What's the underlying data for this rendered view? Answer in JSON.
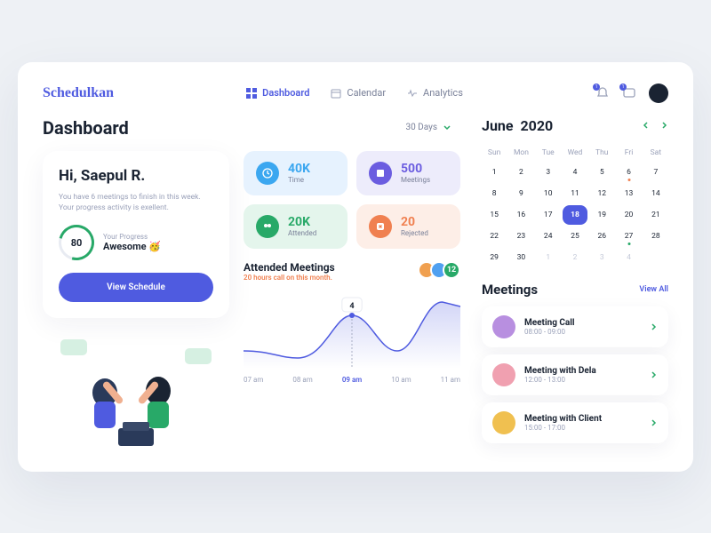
{
  "brand": "Schedulkan",
  "nav": {
    "dashboard": "Dashboard",
    "calendar": "Calendar",
    "analytics": "Analytics"
  },
  "notifications": {
    "bell_count": "1",
    "msg_count": "1"
  },
  "page_title": "Dashboard",
  "filter": {
    "label": "30 Days"
  },
  "greeting": {
    "title": "Hi, Saepul R.",
    "line1": "You have 6 meetings to finish in this week.",
    "line2": "Your progress activity is exellent.",
    "progress_label": "Your Progress",
    "progress_value": "Awesome 🥳",
    "progress_pct": "80",
    "button": "View Schedule"
  },
  "stats": {
    "time": {
      "value": "40K",
      "label": "Time"
    },
    "meetings": {
      "value": "500",
      "label": "Meetings"
    },
    "attended": {
      "value": "20K",
      "label": "Attended"
    },
    "rejected": {
      "value": "20",
      "label": "Rejected"
    }
  },
  "chart_data": {
    "type": "line",
    "title": "Attended Meetings",
    "subtitle_prefix": "20 hours",
    "subtitle_rest": " call on this month.",
    "categories": [
      "07 am",
      "08 am",
      "09 am",
      "10 am",
      "11 am"
    ],
    "series": [
      {
        "name": "Attended",
        "values": [
          1.0,
          0.5,
          4.0,
          1.0,
          5.0
        ]
      }
    ],
    "highlight": {
      "index": 2,
      "label": "4"
    },
    "active_tick_index": 2,
    "extra_attendees_badge": "12"
  },
  "calendar": {
    "month": "June",
    "year": "2020",
    "dow": [
      "Sun",
      "Mon",
      "Tue",
      "Wed",
      "Thu",
      "Fri",
      "Sat"
    ],
    "days": [
      {
        "n": "1"
      },
      {
        "n": "2"
      },
      {
        "n": "3"
      },
      {
        "n": "4"
      },
      {
        "n": "5"
      },
      {
        "n": "6",
        "dot": "orange"
      },
      {
        "n": "7"
      },
      {
        "n": "8"
      },
      {
        "n": "9"
      },
      {
        "n": "10"
      },
      {
        "n": "11"
      },
      {
        "n": "12"
      },
      {
        "n": "13"
      },
      {
        "n": "14"
      },
      {
        "n": "15"
      },
      {
        "n": "16"
      },
      {
        "n": "17"
      },
      {
        "n": "18",
        "selected": true
      },
      {
        "n": "19"
      },
      {
        "n": "20"
      },
      {
        "n": "21"
      },
      {
        "n": "22"
      },
      {
        "n": "23"
      },
      {
        "n": "24"
      },
      {
        "n": "25"
      },
      {
        "n": "26"
      },
      {
        "n": "27",
        "dot": "green"
      },
      {
        "n": "28"
      },
      {
        "n": "29"
      },
      {
        "n": "30"
      },
      {
        "n": "1",
        "other": true
      },
      {
        "n": "2",
        "other": true
      },
      {
        "n": "3",
        "other": true
      },
      {
        "n": "4",
        "other": true
      },
      {
        "n": ""
      }
    ]
  },
  "meetings": {
    "title": "Meetings",
    "view_all": "View All",
    "items": [
      {
        "name": "Meeting Call",
        "time": "08:00 - 09:00",
        "color": "#b88fe0"
      },
      {
        "name": "Meeting with Dela",
        "time": "12:00 - 13:00",
        "color": "#f0a0b0"
      },
      {
        "name": "Meeting with Client",
        "time": "15:00 - 17:00",
        "color": "#f0c050"
      }
    ]
  }
}
